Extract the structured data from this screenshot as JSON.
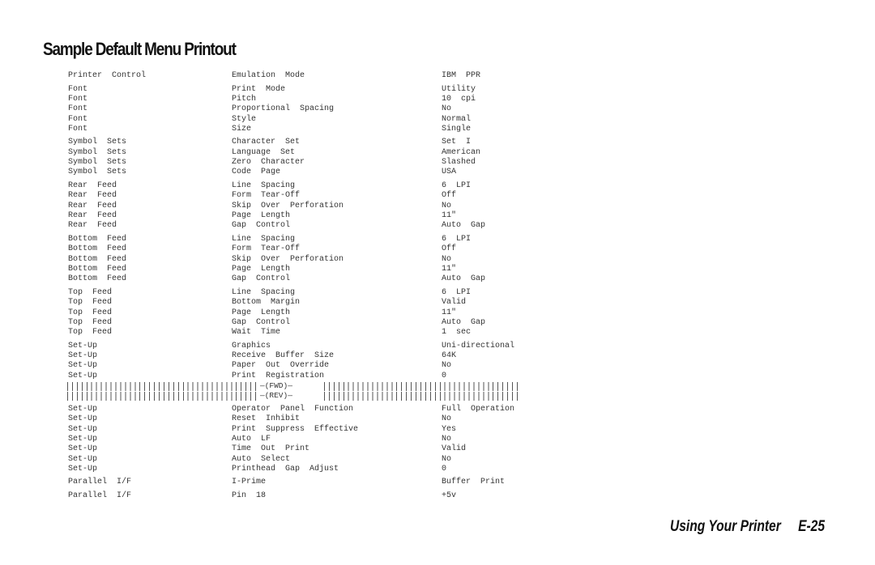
{
  "page": {
    "title": "Sample Default Menu Printout",
    "footer_section": "Using Your Printer",
    "footer_page": "E-25"
  },
  "menu_groups": [
    {
      "rows": [
        [
          "Printer  Control",
          "Emulation  Mode",
          "IBM  PPR"
        ]
      ]
    },
    {
      "rows": [
        [
          "Font",
          "Print  Mode",
          "Utility"
        ],
        [
          "Font",
          "Pitch",
          "10  cpi"
        ],
        [
          "Font",
          "Proportional  Spacing",
          "No"
        ],
        [
          "Font",
          "Style",
          "Normal"
        ],
        [
          "Font",
          "Size",
          "Single"
        ]
      ]
    },
    {
      "rows": [
        [
          "Symbol  Sets",
          "Character  Set",
          "Set  I"
        ],
        [
          "Symbol  Sets",
          "Language  Set",
          "American"
        ],
        [
          "Symbol  Sets",
          "Zero  Character",
          "Slashed"
        ],
        [
          "Symbol  Sets",
          "Code  Page",
          "USA"
        ]
      ]
    },
    {
      "rows": [
        [
          "Rear  Feed",
          "Line  Spacing",
          "6  LPI"
        ],
        [
          "Rear  Feed",
          "Form  Tear-Off",
          "Off"
        ],
        [
          "Rear  Feed",
          "Skip  Over  Perforation",
          "No"
        ],
        [
          "Rear  Feed",
          "Page  Length",
          "11″"
        ],
        [
          "Rear  Feed",
          "Gap  Control",
          "Auto  Gap"
        ]
      ]
    },
    {
      "rows": [
        [
          "Bottom  Feed",
          "Line  Spacing",
          "6  LPI"
        ],
        [
          "Bottom  Feed",
          "Form  Tear-Off",
          "Off"
        ],
        [
          "Bottom  Feed",
          "Skip  Over  Perforation",
          "No"
        ],
        [
          "Bottom  Feed",
          "Page  Length",
          "11″"
        ],
        [
          "Bottom  Feed",
          "Gap  Control",
          "Auto  Gap"
        ]
      ]
    },
    {
      "rows": [
        [
          "Top  Feed",
          "Line  Spacing",
          "6  LPI"
        ],
        [
          "Top  Feed",
          "Bottom  Margin",
          "Valid"
        ],
        [
          "Top  Feed",
          "Page  Length",
          "11″"
        ],
        [
          "Top  Feed",
          "Gap  Control",
          "Auto  Gap"
        ],
        [
          "Top  Feed",
          "Wait  Time",
          "1  sec"
        ]
      ]
    },
    {
      "rows": [
        [
          "Set-Up",
          "Graphics",
          "Uni-directional"
        ],
        [
          "Set-Up",
          "Receive  Buffer  Size",
          "64K"
        ],
        [
          "Set-Up",
          "Paper  Out  Override",
          "No"
        ],
        [
          "Set-Up",
          "Print  Registration",
          "0"
        ]
      ],
      "registration_pattern": {
        "fwd_label": "—(FWD)—",
        "rev_label": "—(REV)—"
      }
    },
    {
      "rows": [
        [
          "Set-Up",
          "Operator  Panel  Function",
          "Full  Operation"
        ],
        [
          "Set-Up",
          "Reset  Inhibit",
          "No"
        ],
        [
          "Set-Up",
          "Print  Suppress  Effective",
          "Yes"
        ],
        [
          "Set-Up",
          "Auto  LF",
          "No"
        ],
        [
          "Set-Up",
          "Time  Out  Print",
          "Valid"
        ],
        [
          "Set-Up",
          "Auto  Select",
          "No"
        ],
        [
          "Set-Up",
          "Printhead  Gap  Adjust",
          "0"
        ]
      ]
    },
    {
      "rows": [
        [
          "Parallel  I/F",
          "I-Prime",
          "Buffer  Print"
        ]
      ]
    },
    {
      "rows": [
        [
          "Parallel  I/F",
          "Pin  18",
          "+5v"
        ]
      ]
    }
  ]
}
